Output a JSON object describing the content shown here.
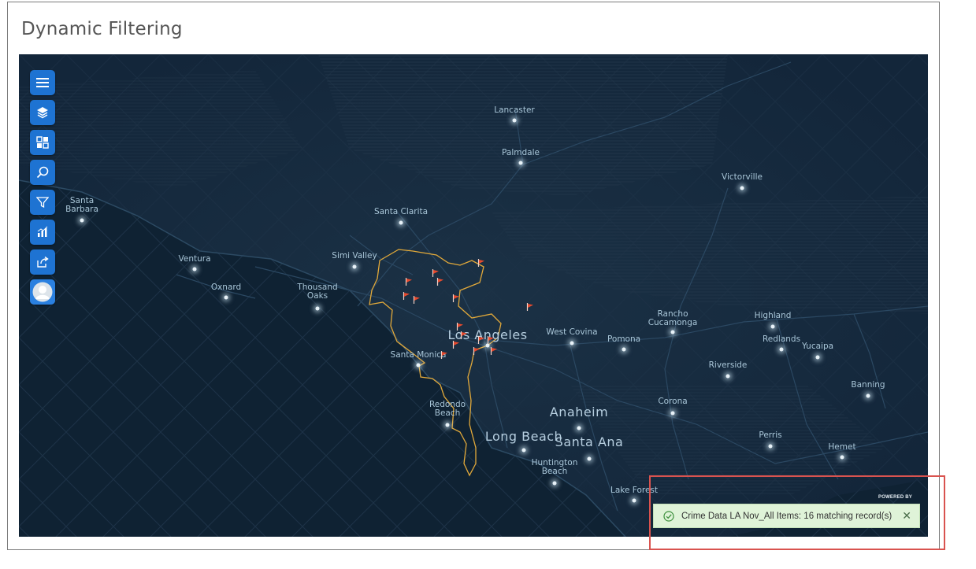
{
  "title": "Dynamic Filtering",
  "toolbar": {
    "buttons": [
      {
        "name": "menu-button",
        "icon": "hamburger-icon"
      },
      {
        "name": "layers-button",
        "icon": "layers-icon"
      },
      {
        "name": "basemap-button",
        "icon": "basemap-grid-icon"
      },
      {
        "name": "search-button",
        "icon": "search-icon"
      },
      {
        "name": "filter-button",
        "icon": "filter-funnel-icon"
      },
      {
        "name": "analytics-button",
        "icon": "bar-chart-icon"
      },
      {
        "name": "share-button",
        "icon": "share-icon"
      },
      {
        "name": "profile-button",
        "icon": "user-avatar-icon"
      }
    ]
  },
  "map": {
    "cities": [
      {
        "label": "Lancaster"
      },
      {
        "label": "Palmdale"
      },
      {
        "label": "Victorville"
      },
      {
        "label": "Santa\nBarbara"
      },
      {
        "label": "Santa Clarita"
      },
      {
        "label": "Ventura"
      },
      {
        "label": "Simi Valley"
      },
      {
        "label": "Oxnard"
      },
      {
        "label": "Thousand\nOaks"
      },
      {
        "label": "Rancho\nCucamonga"
      },
      {
        "label": "Highland"
      },
      {
        "label": "Redlands"
      },
      {
        "label": "Yucaipa"
      },
      {
        "label": "West Covina"
      },
      {
        "label": "Pomona"
      },
      {
        "label": "Riverside"
      },
      {
        "label": "Los Angeles"
      },
      {
        "label": "Santa Monica"
      },
      {
        "label": "Banning"
      },
      {
        "label": "Corona"
      },
      {
        "label": "Redondo\nBeach"
      },
      {
        "label": "Anaheim"
      },
      {
        "label": "Long Beach"
      },
      {
        "label": "Santa Ana"
      },
      {
        "label": "Perris"
      },
      {
        "label": "Hemet"
      },
      {
        "label": "Huntington\nBeach"
      },
      {
        "label": "Lake Forest"
      }
    ],
    "flag_count": 16,
    "powered_by": "POWERED BY",
    "colors": {
      "background": "#0d1d2c",
      "boundary": "#e2a93a",
      "flag": "#e64a2e"
    }
  },
  "toast": {
    "message": "Crime Data LA Nov_All Items: 16 matching record(s)",
    "status_icon": "check-circle-icon",
    "close_icon": "close-icon",
    "background": "#dff3d8"
  },
  "annotation": {
    "color": "#d9534f"
  }
}
